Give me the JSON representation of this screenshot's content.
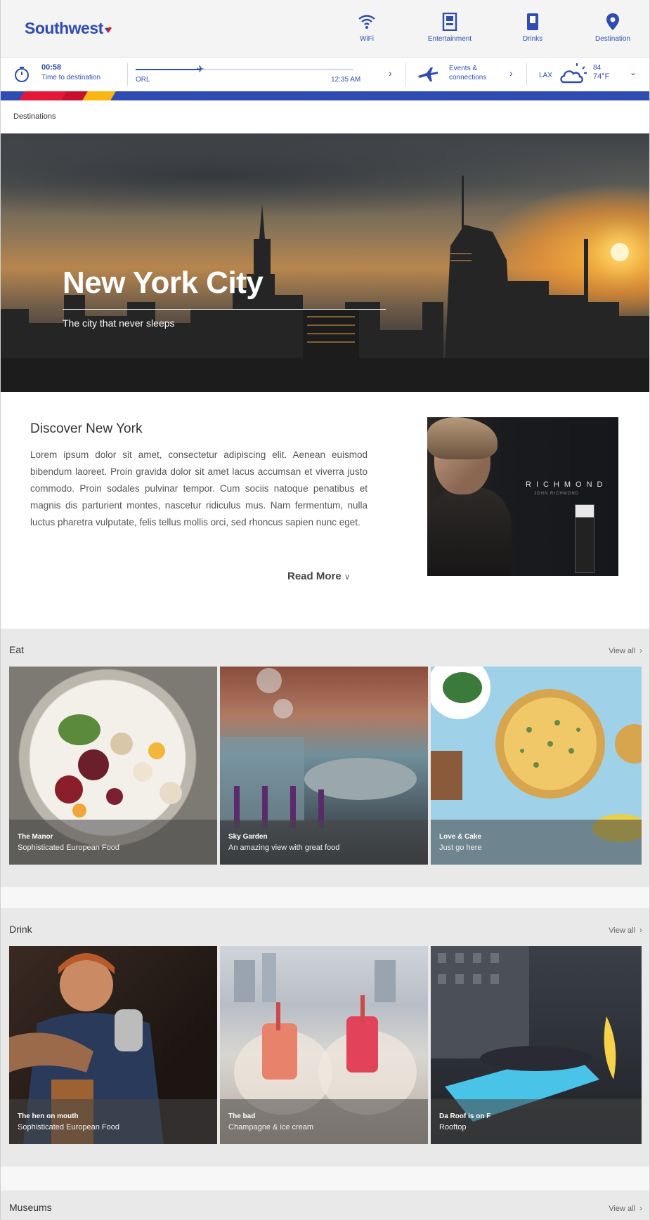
{
  "header": {
    "logo": "Southwest",
    "nav": [
      {
        "label": "WiFi",
        "icon": "wifi-icon"
      },
      {
        "label": "Entertainment",
        "icon": "entertainment-icon"
      },
      {
        "label": "Drinks",
        "icon": "drinks-icon"
      },
      {
        "label": "Destination",
        "icon": "location-pin-icon"
      }
    ]
  },
  "flight": {
    "time": "00:58",
    "time_label": "Time to destination",
    "origin": "ORL",
    "eta": "12:35 AM",
    "progress": 0.3,
    "connections_line1": "Events &",
    "connections_line2": "connections",
    "dest_code": "LAX",
    "temp_line1": "84",
    "temp_line2": "74°F"
  },
  "colors": {
    "brand_blue": "#304cb2",
    "stripe_red": "#e31837",
    "stripe_yellow": "#f9b612"
  },
  "breadcrumb": "Destinations",
  "hero": {
    "title": "New York City",
    "subtitle": "The city that never sleeps"
  },
  "discover": {
    "title": "Discover New York",
    "body": "Lorem ipsum dolor sit amet, consectetur adipiscing elit. Aenean euismod bibendum laoreet. Proin gravida dolor sit amet lacus accumsan et viverra justo commodo. Proin sodales pulvinar tempor. Cum sociis natoque penatibus et magnis dis parturient montes, nascetur ridiculus mus. Nam fermentum, nulla luctus pharetra vulputate, felis tellus mollis orci, sed rhoncus sapien nunc eget.",
    "read_more": "Read More",
    "ad_brand": "RICHMOND",
    "ad_small": "JOHN RICHMOND"
  },
  "sections": {
    "eat": {
      "title": "Eat",
      "view_all": "View all",
      "cards": [
        {
          "name": "The Manor",
          "desc": "Sophisticated European Food"
        },
        {
          "name": "Sky Garden",
          "desc": "An amazing view with great food"
        },
        {
          "name": "Love & Cake",
          "desc": "Just go here"
        }
      ]
    },
    "drink": {
      "title": "Drink",
      "view_all": "View all",
      "cards": [
        {
          "name": "The hen on mouth",
          "desc": "Sophisticated European Food"
        },
        {
          "name": "The bad",
          "desc": "Champagne & ice cream"
        },
        {
          "name": "Da Roof is on F",
          "desc": "Rooftop"
        }
      ]
    },
    "museums": {
      "title": "Museums",
      "view_all": "View all"
    }
  }
}
